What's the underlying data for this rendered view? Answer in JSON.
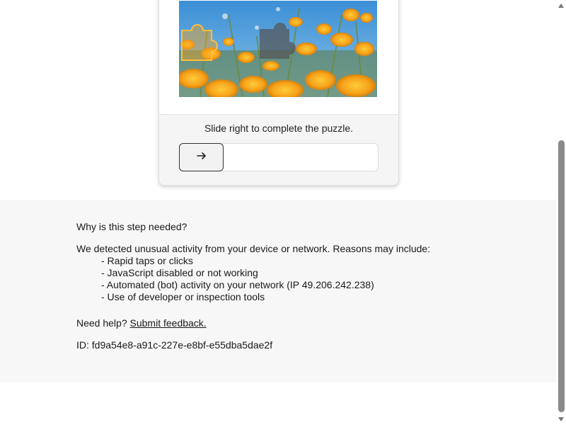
{
  "captcha": {
    "prompt": "Slide right to complete the puzzle.",
    "handle_icon": "arrow-right-icon"
  },
  "info": {
    "why_heading": "Why is this step needed?",
    "reasons_intro": "We detected unusual activity from your device or network. Reasons may include:",
    "reasons": [
      "- Rapid taps or clicks",
      "- JavaScript disabled or not working",
      "- Automated (bot) activity on your network (IP 49.206.242.238)",
      "- Use of developer or inspection tools"
    ],
    "help_prefix": "Need help?",
    "help_link": "Submit feedback.",
    "id_line": "ID: fd9a54e8-a91c-227e-e8bf-e55dba5dae2f"
  },
  "colors": {
    "flower": "#f6a21a",
    "sky": "#4a9bd8",
    "info_bg": "#f7f7f7"
  }
}
